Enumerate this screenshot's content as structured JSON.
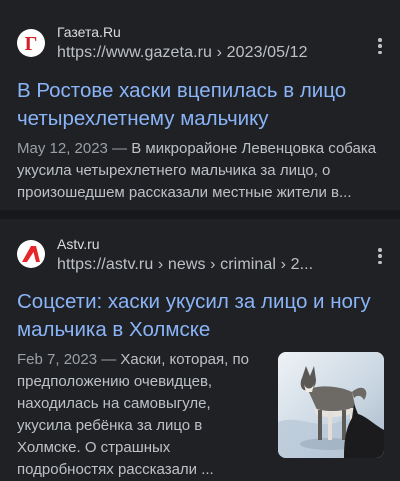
{
  "results": [
    {
      "site_name": "Газета.Ru",
      "favicon_letter": "Г",
      "favicon_color": "#d22127",
      "url": "https://www.gazeta.ru › 2023/05/12",
      "title": "В Ростове хаски вцепилась в лицо четырехлетнему мальчику",
      "date": "May 12, 2023 —",
      "snippet": " В микрорайоне Левенцовка собака укусила четырехлетнего мальчика за лицо, о произошедшем рассказали местные жители в..."
    },
    {
      "site_name": "Astv.ru",
      "favicon_icon": "astv-logo-icon",
      "favicon_color": "#e8262a",
      "url": "https://astv.ru › news › criminal › 2...",
      "title": "Соцсети: хаски укусил за лицо и ногу мальчика в Холмске",
      "date": "Feb 7, 2023 —",
      "snippet": " Хаски, которая, по предположению очевидцев, находилась на самовыгуле, укусила ребёнка за лицо в Холмске. О страшных подробностях рассказали ...",
      "thumbnail": "husky-on-snow-photo"
    }
  ]
}
